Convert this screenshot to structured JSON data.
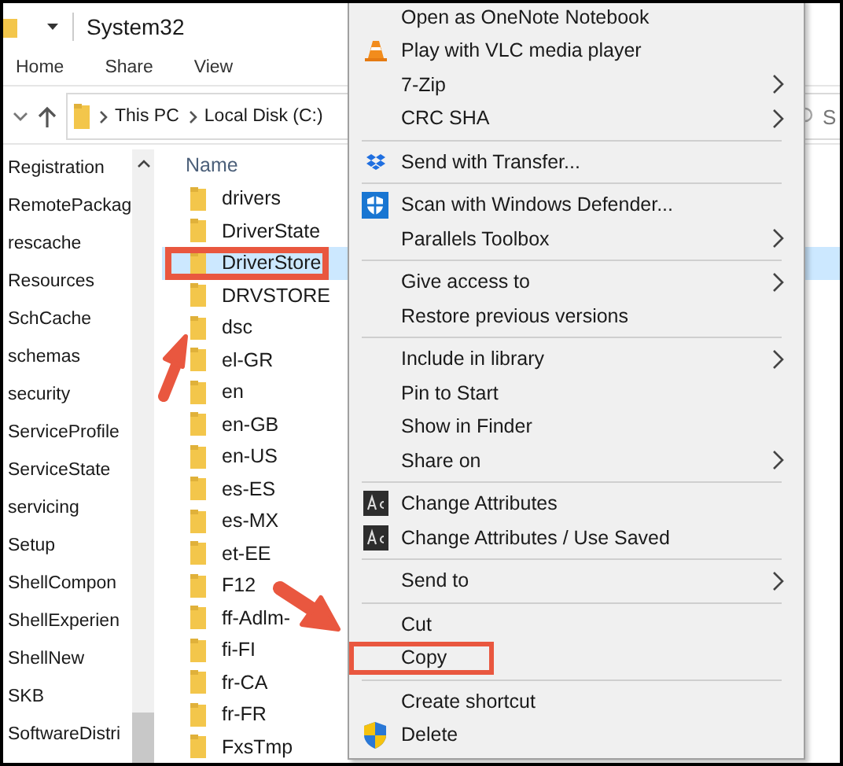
{
  "window": {
    "title": "System32"
  },
  "ribbon_tabs": [
    {
      "label": "Home"
    },
    {
      "label": "Share"
    },
    {
      "label": "View"
    }
  ],
  "address": {
    "path": [
      "This PC",
      "Local Disk (C:)"
    ]
  },
  "search": {
    "placeholder": "S"
  },
  "nav_pane": {
    "items": [
      "Registration",
      "RemotePackag",
      "rescache",
      "Resources",
      "SchCache",
      "schemas",
      "security",
      "ServiceProfile",
      "ServiceState",
      "servicing",
      "Setup",
      "ShellCompon",
      "ShellExperien",
      "ShellNew",
      "SKB",
      "SoftwareDistri"
    ]
  },
  "file_list": {
    "column": "Name",
    "rows": [
      {
        "name": "drivers",
        "selected": false,
        "highlighted": false
      },
      {
        "name": "DriverState",
        "selected": false,
        "highlighted": false
      },
      {
        "name": "DriverStore",
        "selected": true,
        "highlighted": true
      },
      {
        "name": "DRVSTORE",
        "selected": false,
        "highlighted": false
      },
      {
        "name": "dsc",
        "selected": false,
        "highlighted": false
      },
      {
        "name": "el-GR",
        "selected": false,
        "highlighted": false
      },
      {
        "name": "en",
        "selected": false,
        "highlighted": false
      },
      {
        "name": "en-GB",
        "selected": false,
        "highlighted": false
      },
      {
        "name": "en-US",
        "selected": false,
        "highlighted": false
      },
      {
        "name": "es-ES",
        "selected": false,
        "highlighted": false
      },
      {
        "name": "es-MX",
        "selected": false,
        "highlighted": false
      },
      {
        "name": "et-EE",
        "selected": false,
        "highlighted": false
      },
      {
        "name": "F12",
        "selected": false,
        "highlighted": false
      },
      {
        "name": "ff-Adlm-",
        "selected": false,
        "highlighted": false
      },
      {
        "name": "fi-FI",
        "selected": false,
        "highlighted": false
      },
      {
        "name": "fr-CA",
        "selected": false,
        "highlighted": false
      },
      {
        "name": "fr-FR",
        "selected": false,
        "highlighted": false
      },
      {
        "name": "FxsTmp",
        "selected": false,
        "highlighted": false
      }
    ]
  },
  "context_menu": {
    "groups": [
      [
        {
          "label": "Open as OneNote Notebook",
          "kind": "plain",
          "submenu": false,
          "highlighted": false
        },
        {
          "label": "Play with VLC media player",
          "kind": "cone",
          "submenu": false,
          "highlighted": false
        },
        {
          "label": "7-Zip",
          "kind": "plain",
          "submenu": true,
          "highlighted": false
        },
        {
          "label": "CRC SHA",
          "kind": "plain",
          "submenu": true,
          "highlighted": false
        }
      ],
      [
        {
          "label": "Send with Transfer...",
          "kind": "boxes",
          "submenu": false,
          "highlighted": false
        }
      ],
      [
        {
          "label": "Scan with Windows Defender...",
          "kind": "shield",
          "submenu": false,
          "highlighted": false
        },
        {
          "label": "Parallels Toolbox",
          "kind": "plain",
          "submenu": true,
          "highlighted": false
        }
      ],
      [
        {
          "label": "Give access to",
          "kind": "plain",
          "submenu": true,
          "highlighted": false
        },
        {
          "label": "Restore previous versions",
          "kind": "plain",
          "submenu": false,
          "highlighted": false
        }
      ],
      [
        {
          "label": "Include in library",
          "kind": "plain",
          "submenu": true,
          "highlighted": false
        },
        {
          "label": "Pin to Start",
          "kind": "plain",
          "submenu": false,
          "highlighted": false
        },
        {
          "label": "Show in Finder",
          "kind": "plain",
          "submenu": false,
          "highlighted": false
        },
        {
          "label": "Share on",
          "kind": "plain",
          "submenu": true,
          "highlighted": false
        }
      ],
      [
        {
          "label": "Change Attributes",
          "kind": "tile",
          "submenu": false,
          "highlighted": false
        },
        {
          "label": "Change Attributes / Use Saved",
          "kind": "tile",
          "submenu": false,
          "highlighted": false
        }
      ],
      [
        {
          "label": "Send to",
          "kind": "plain",
          "submenu": true,
          "highlighted": false
        }
      ],
      [
        {
          "label": "Cut",
          "kind": "plain",
          "submenu": false,
          "highlighted": false
        },
        {
          "label": "Copy",
          "kind": "plain",
          "submenu": false,
          "highlighted": true
        }
      ],
      [
        {
          "label": "Create shortcut",
          "kind": "plain",
          "submenu": false,
          "highlighted": false
        },
        {
          "label": "Delete",
          "kind": "uac",
          "submenu": false,
          "highlighted": false
        }
      ]
    ]
  }
}
